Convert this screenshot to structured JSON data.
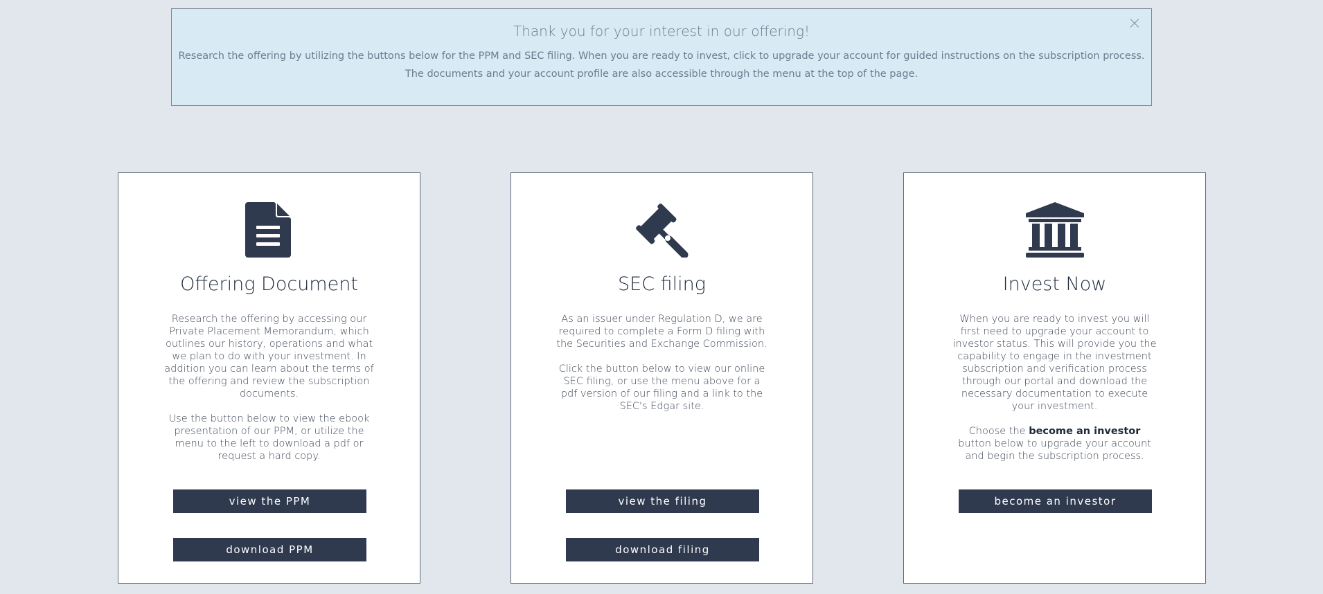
{
  "alert": {
    "title": "Thank you for your interest in our offering!",
    "line1": "Research the offering by utilizing the buttons below for the PPM and SEC filing. When you are ready to invest, click to upgrade your account for guided instructions on the subscription process.",
    "line2": "The documents and your account profile are also accessible through the menu at the top of the page.",
    "close_icon": "×"
  },
  "cards": [
    {
      "icon": "document-icon",
      "title": "Offering Document",
      "para1": "Research the offering by accessing our Private Placement Memorandum, which outlines our history, operations and what we plan to do with your investment. In addition you can learn about the terms of the offering and review the subscription documents.",
      "para2": "Use the button below to view the ebook presentation of our PPM, or utilize the menu to the left to download a pdf or request a hard copy.",
      "button1": "view the PPM",
      "button2": "download PPM"
    },
    {
      "icon": "gavel-icon",
      "title": "SEC filing",
      "para1": "As an issuer under Regulation D, we are required to complete a Form D filing with the Securities and Exchange Commission.",
      "para2": "Click the button below to view our online SEC filing, or use the menu above for a pdf version of our filing and a link to the SEC's Edgar site.",
      "button1": "view the filing",
      "button2": "download filing"
    },
    {
      "icon": "bank-icon",
      "title": "Invest Now",
      "para1": "When you are ready to invest you will first need to upgrade your account to investor status. This will provide you the capability to engage in the investment subscription and verification process through our portal and download the necessary documentation to execute your investment.",
      "para2_prefix": "Choose the ",
      "para2_bold": "become an investor",
      "para2_suffix": " button below to upgrade your account and begin the subscription process.",
      "button1": "become an investor"
    }
  ],
  "colors": {
    "background": "#e1e7ed",
    "alert_bg": "#d8eaf4",
    "button_bg": "#2f3a4f",
    "icon": "#2f3a4f"
  }
}
